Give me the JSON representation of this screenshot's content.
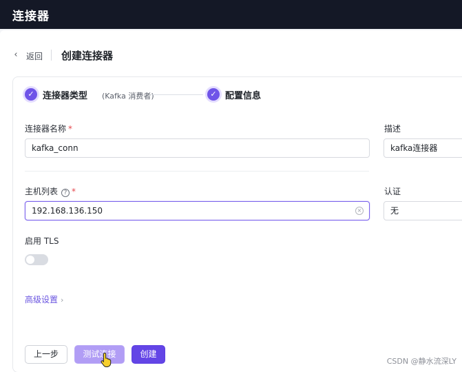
{
  "app": {
    "title": "连接器"
  },
  "breadcrumb": {
    "back_label": "返回",
    "page_title": "创建连接器"
  },
  "steps": [
    {
      "label": "连接器类型",
      "sub": "(Kafka 消费者)",
      "status": "done"
    },
    {
      "label": "配置信息",
      "sub": "",
      "status": "active"
    }
  ],
  "form": {
    "name": {
      "label": "连接器名称",
      "required_mark": "*",
      "value": "kafka_conn"
    },
    "description": {
      "label": "描述",
      "value": "kafka连接器"
    },
    "hosts": {
      "label": "主机列表",
      "help_icon": "?",
      "required_mark": "*",
      "value": "192.168.136.150"
    },
    "auth": {
      "label": "认证",
      "value": "无"
    },
    "tls": {
      "label": "启用 TLS",
      "enabled": false
    },
    "advanced": {
      "label": "高级设置",
      "chevron": "›"
    }
  },
  "buttons": {
    "prev": "上一步",
    "test": "测试连接",
    "create": "创建"
  },
  "watermark": "CSDN @静水流深LY",
  "icons": {
    "back": "‹",
    "check": "✓",
    "clear": "×"
  },
  "colors": {
    "accent": "#6345e6",
    "topbar": "#141826",
    "required": "#e5484d"
  }
}
